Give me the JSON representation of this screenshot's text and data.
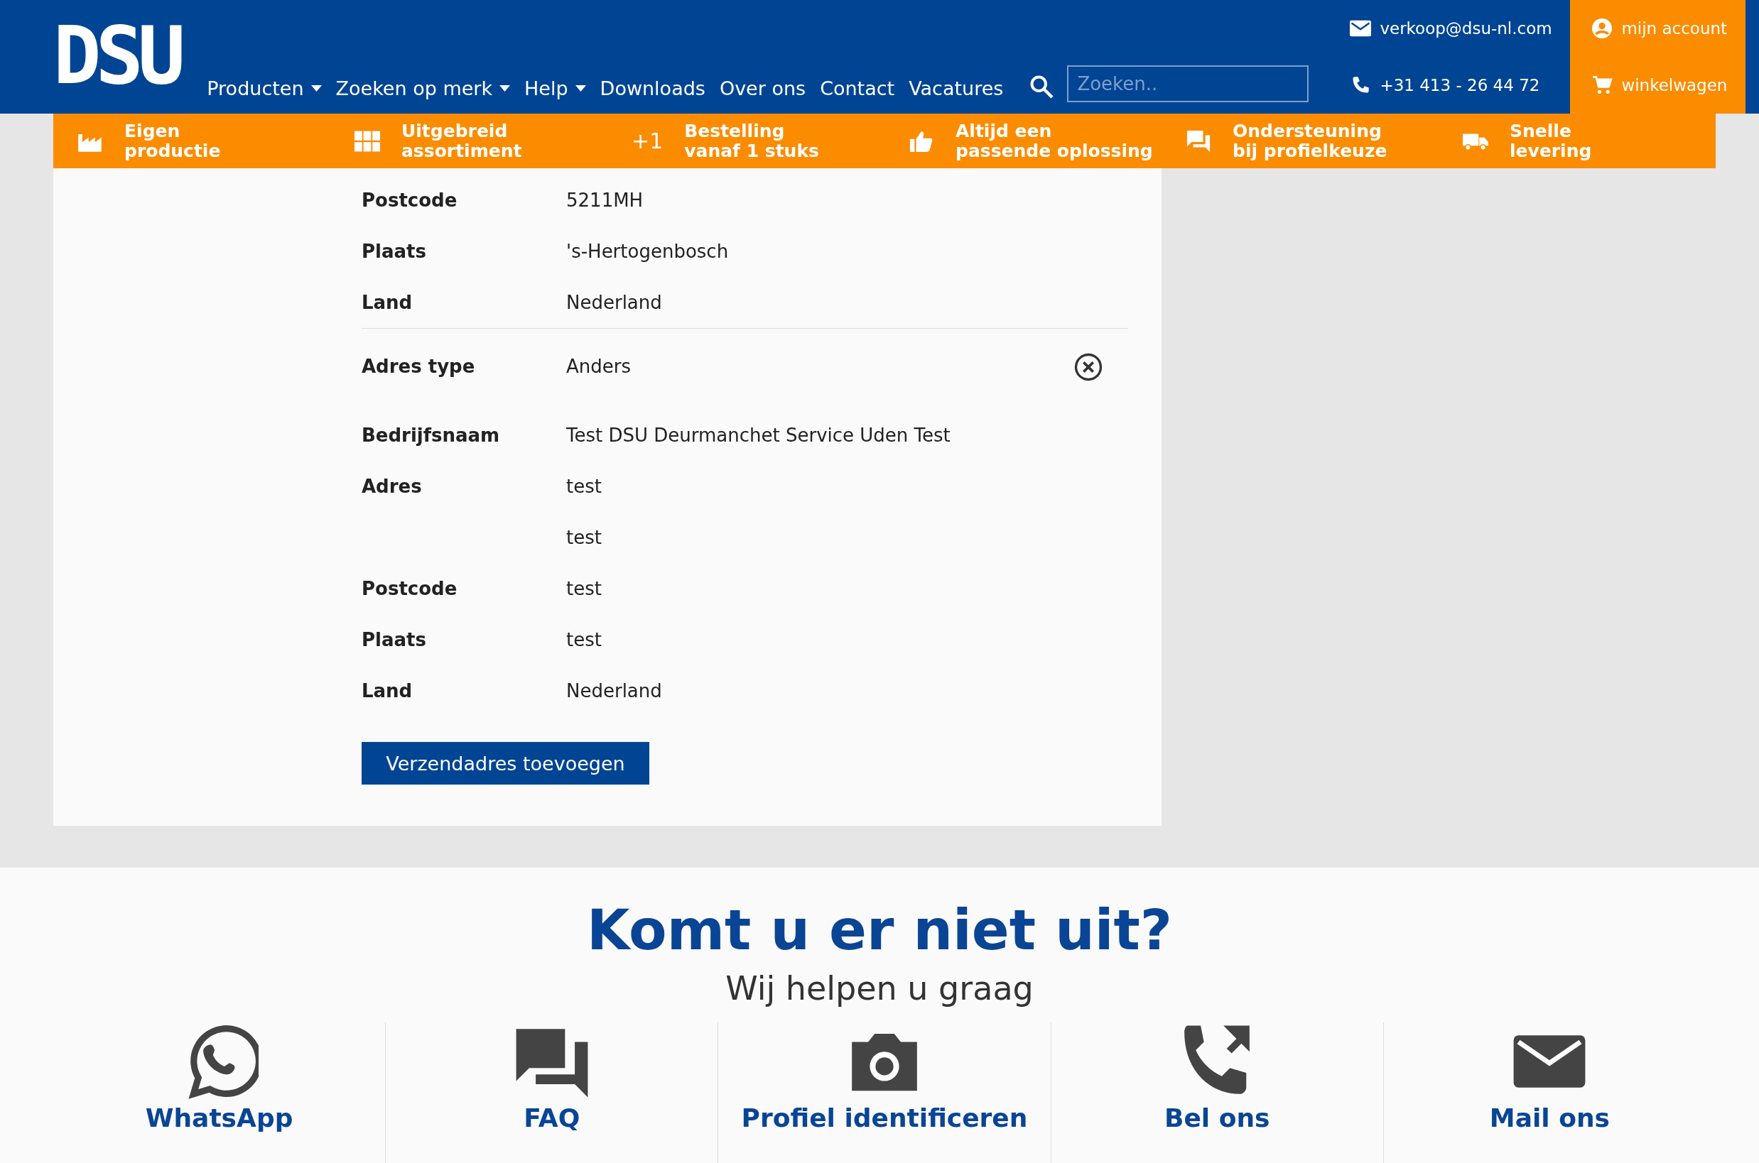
{
  "logo": {
    "text": "DSU"
  },
  "nav": [
    {
      "label": "Producten",
      "dropdown": true
    },
    {
      "label": "Zoeken op merk",
      "dropdown": true
    },
    {
      "label": "Help",
      "dropdown": true
    },
    {
      "label": "Downloads",
      "dropdown": false
    },
    {
      "label": "Over ons",
      "dropdown": false
    },
    {
      "label": "Contact",
      "dropdown": false
    },
    {
      "label": "Vacatures",
      "dropdown": false
    }
  ],
  "search": {
    "placeholder": "Zoeken.."
  },
  "contact": {
    "email": "verkoop@dsu-nl.com",
    "phone": "+31 413 - 26 44 72"
  },
  "account": {
    "account": "mijn account",
    "cart": "winkelwagen"
  },
  "usps": [
    {
      "kind": "factory",
      "line1": "Eigen",
      "line2": "productie"
    },
    {
      "kind": "grid",
      "line1": "Uitgebreid",
      "line2": "assortiment"
    },
    {
      "kind": "text",
      "icon_text": "+1",
      "line1": "Bestelling",
      "line2": "vanaf 1 stuks"
    },
    {
      "kind": "thumb",
      "line1": "Altijd een",
      "line2": "passende oplossing"
    },
    {
      "kind": "chat",
      "line1": "Ondersteuning",
      "line2": "bij profielkeuze"
    },
    {
      "kind": "truck",
      "line1": "Snelle",
      "line2": "levering"
    }
  ],
  "address_sections": [
    {
      "rows": [
        {
          "label": "Postcode",
          "value": "5211MH",
          "removable": false
        },
        {
          "label": "Plaats",
          "value": "'s-Hertogenbosch",
          "removable": false
        },
        {
          "label": "Land",
          "value": "Nederland",
          "removable": false
        }
      ]
    },
    {
      "rows": [
        {
          "label": "Adres type",
          "value": "Anders",
          "removable": true
        },
        {
          "label": "Bedrijfsnaam",
          "value": "Test DSU Deurmanchet Service Uden Test",
          "removable": false
        },
        {
          "label": "Adres",
          "value": "test",
          "removable": false
        },
        {
          "value": "test",
          "removable": false
        },
        {
          "label": "Postcode",
          "value": "test",
          "removable": false
        },
        {
          "label": "Plaats",
          "value": "test",
          "removable": false
        },
        {
          "label": "Land",
          "value": "Nederland",
          "removable": false
        }
      ]
    }
  ],
  "add_button": "Verzendadres toevoegen",
  "help": {
    "title": "Komt u er niet uit?",
    "subtitle": "Wij helpen u graag",
    "options": [
      {
        "kind": "whatsapp",
        "label": "WhatsApp"
      },
      {
        "kind": "faq",
        "label": "FAQ"
      },
      {
        "kind": "camera",
        "label": "Profiel identificeren"
      },
      {
        "kind": "call",
        "label": "Bel ons"
      },
      {
        "kind": "mail",
        "label": "Mail ons"
      }
    ]
  }
}
